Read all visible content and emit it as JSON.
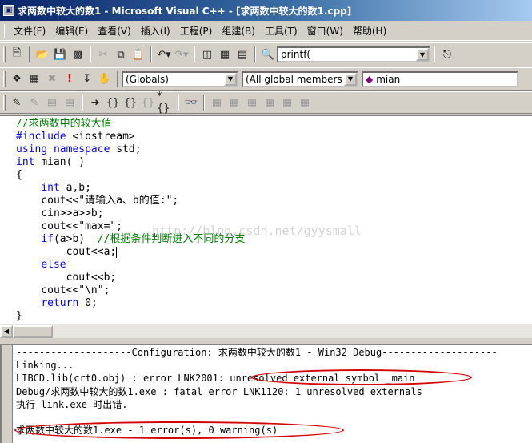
{
  "window": {
    "title": "求两数中较大的数1 - Microsoft Visual C++ - [求两数中较大的数1.cpp]"
  },
  "menubar": {
    "items": [
      "文件(F)",
      "编辑(E)",
      "查看(V)",
      "插入(I)",
      "工程(P)",
      "组建(B)",
      "工具(T)",
      "窗口(W)",
      "帮助(H)"
    ]
  },
  "toolbar1": {
    "find_combo_value": "printf("
  },
  "toolbar2": {
    "class_combo": "(Globals)",
    "filter_combo": "(All global members",
    "member_combo": "mian"
  },
  "editor": {
    "lines": [
      [
        [
          "cm",
          "//求两数中的较大值"
        ]
      ],
      [
        [
          "kw",
          "#include"
        ],
        [
          "",
          " <iostream>"
        ]
      ],
      [
        [
          "kw",
          "using namespace"
        ],
        [
          "",
          " std;"
        ]
      ],
      [
        [
          "kw",
          "int"
        ],
        [
          "",
          " mian( )"
        ]
      ],
      [
        [
          "",
          "{"
        ]
      ],
      [
        [
          "",
          "    "
        ],
        [
          "kw",
          "int"
        ],
        [
          "",
          " a,b;"
        ]
      ],
      [
        [
          "",
          "    cout<<\"请输入a、b的值:\";"
        ]
      ],
      [
        [
          "",
          "    cin>>a>>b;"
        ]
      ],
      [
        [
          "",
          "    cout<<\"max=\";"
        ]
      ],
      [
        [
          "",
          "    "
        ],
        [
          "kw",
          "if"
        ],
        [
          "",
          "(a>b)  "
        ],
        [
          "cm",
          "//根据条件判断进入不同的分支"
        ]
      ],
      [
        [
          "",
          "        cout<<a;"
        ],
        [
          "caret",
          ""
        ]
      ],
      [
        [
          "",
          "    "
        ],
        [
          "kw",
          "else"
        ]
      ],
      [
        [
          "",
          "        cout<<b;"
        ]
      ],
      [
        [
          "",
          "    cout<<\"\\n\";"
        ]
      ],
      [
        [
          "",
          "    "
        ],
        [
          "kw",
          "return"
        ],
        [
          "",
          " 0;"
        ]
      ],
      [
        [
          "",
          "}"
        ]
      ]
    ],
    "watermark": "http://blog.csdn.net/gyysmall"
  },
  "output": {
    "lines": [
      "--------------------Configuration: 求两数中较大的数1 - Win32 Debug--------------------",
      "Linking...",
      "LIBCD.lib(crt0.obj) : error LNK2001: unresolved external symbol _main",
      "Debug/求两数中较大的数1.exe : fatal error LNK1120: 1 unresolved externals",
      "执行 link.exe 时出错.",
      "",
      "求两数中较大的数1.exe - 1 error(s), 0 warning(s)"
    ]
  },
  "colors": {
    "keyword": "#0000ff",
    "comment": "#008000",
    "annotation": "#d40000"
  }
}
